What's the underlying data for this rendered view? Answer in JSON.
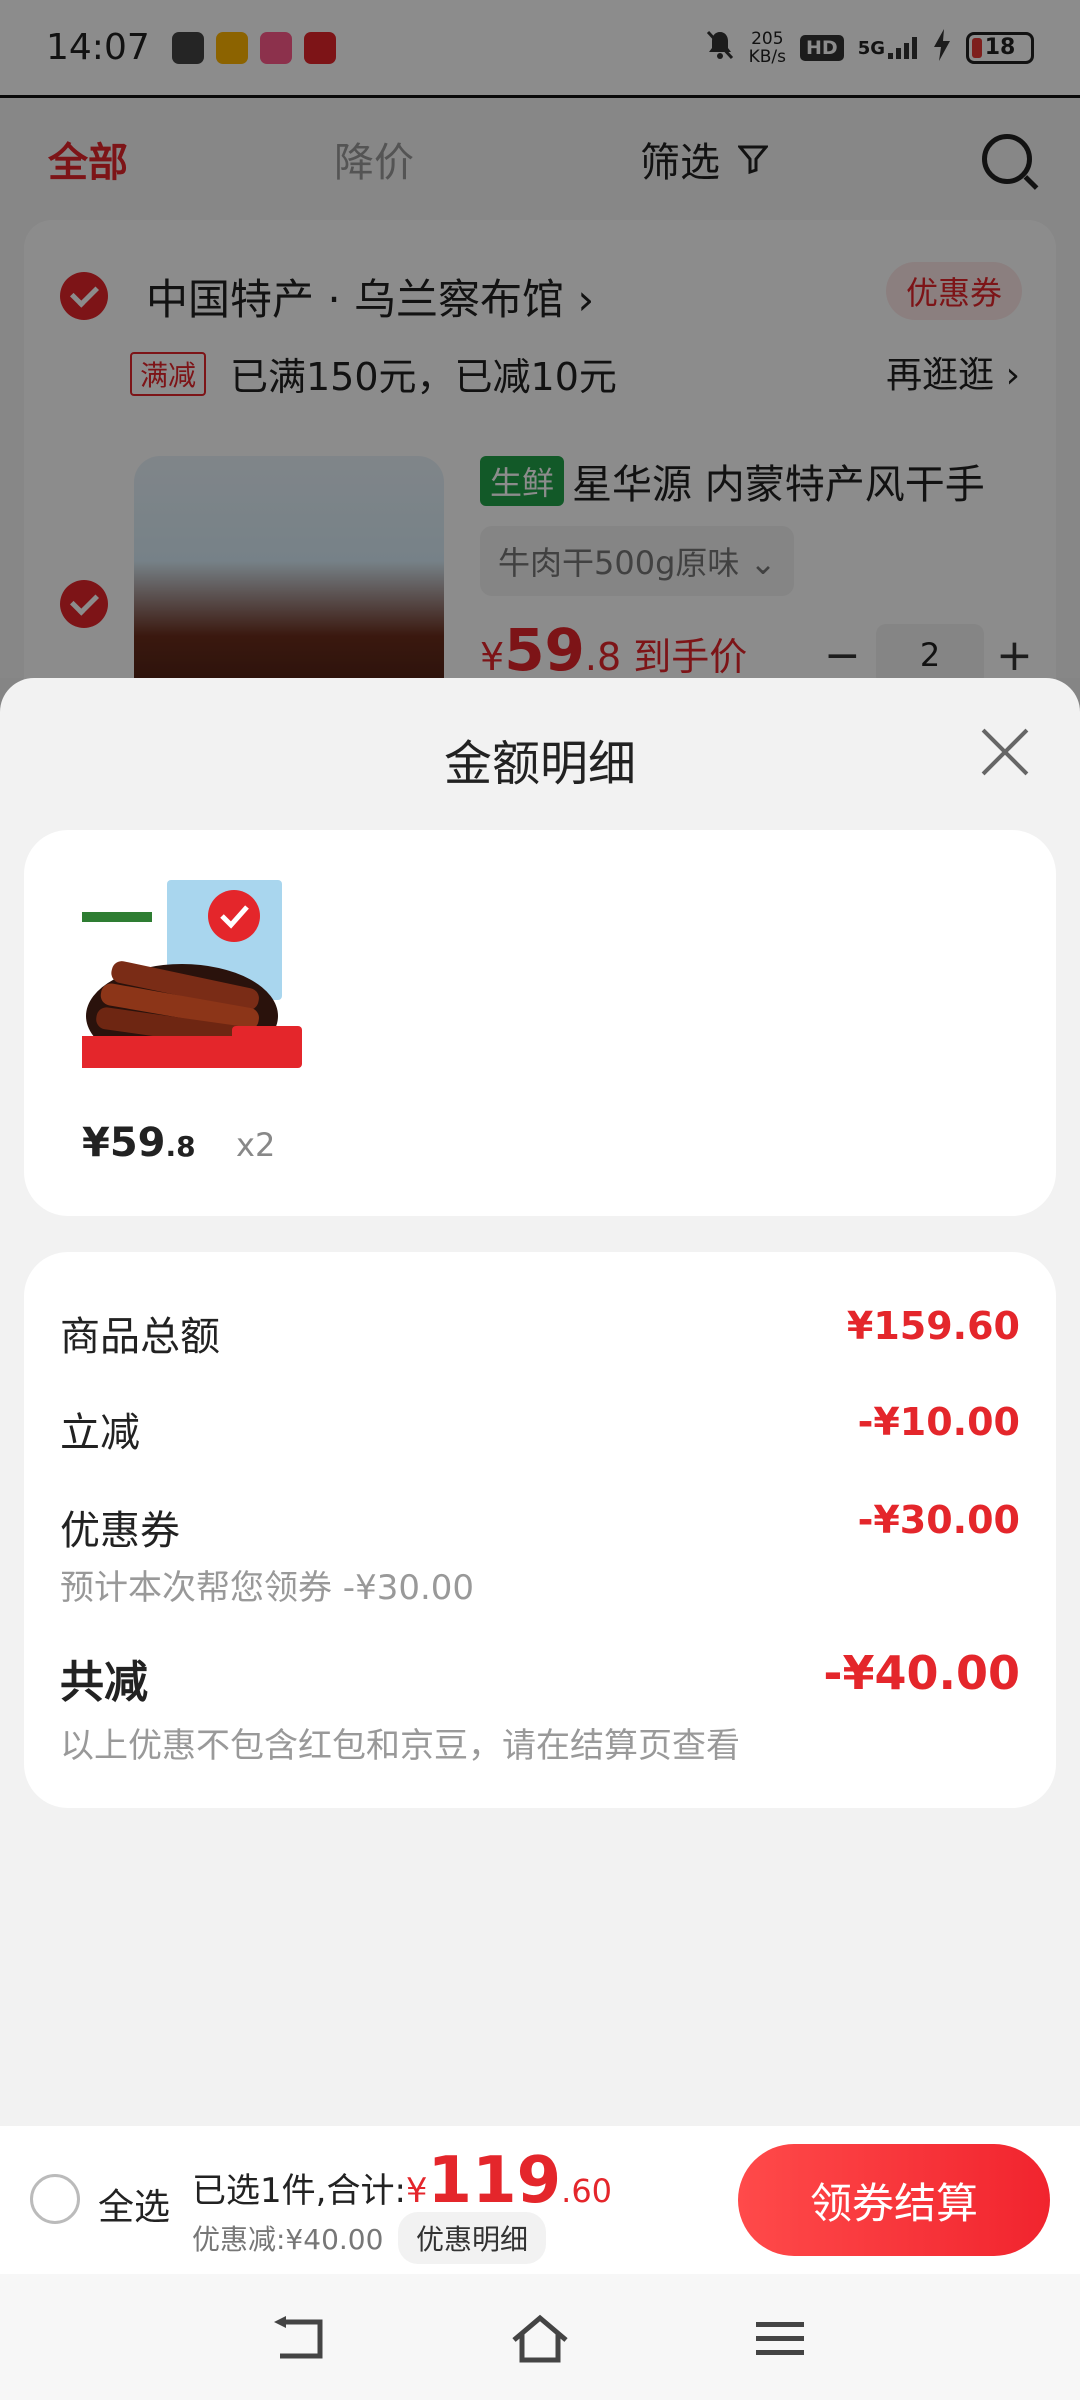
{
  "status_bar": {
    "time": "14:07",
    "net_speed_value": "205",
    "net_speed_unit": "KB/s",
    "hd": "HD",
    "signal": "5G",
    "battery": "18"
  },
  "tabs": {
    "all": "全部",
    "price_drop": "降价",
    "filter": "筛选"
  },
  "shop": {
    "name": "中国特产 · 乌兰察布馆 ›",
    "coupon": "优惠券",
    "full_tag": "满减",
    "full_text": "已满150元，已减10元",
    "go_more": "再逛逛 ›",
    "product_tag": "生鲜",
    "product_title": "星华源 内蒙特产风干手",
    "sku": "牛肉干500g原味 ⌄",
    "price_prefix": "¥",
    "price_int": "59",
    "price_suffix": ".8 到手价",
    "qty": "2"
  },
  "sheet": {
    "title": "金额明细",
    "item": {
      "price_int": "¥59",
      "price_dec": ".8",
      "qty": "x2"
    },
    "rows": {
      "goods_total_label": "商品总额",
      "goods_total_value": "¥159.60",
      "instant_label": "立减",
      "instant_value": "-¥10.00",
      "coupon_label": "优惠券",
      "coupon_value": "-¥30.00",
      "coupon_sub": "预计本次帮您领券 -¥30.00",
      "total_label": "共减",
      "total_value": "-¥40.00",
      "total_sub": "以上优惠不包含红包和京豆，请在结算页查看"
    }
  },
  "bottom": {
    "select_all": "全选",
    "summary_prefix": "已选1件,合计:",
    "yen": "¥",
    "total_int": "119",
    "total_dec": ".60",
    "discount": "优惠减:¥40.00",
    "detail": "优惠明细",
    "checkout": "领券结算"
  },
  "colors": {
    "accent": "#e4262b",
    "fresh_green": "#22a34a"
  },
  "icons": [
    "mute-bell-icon",
    "signal-icon",
    "charging-icon",
    "battery-icon",
    "filter-funnel-icon",
    "search-icon",
    "close-icon",
    "back-icon",
    "home-icon",
    "menu-icon"
  ]
}
